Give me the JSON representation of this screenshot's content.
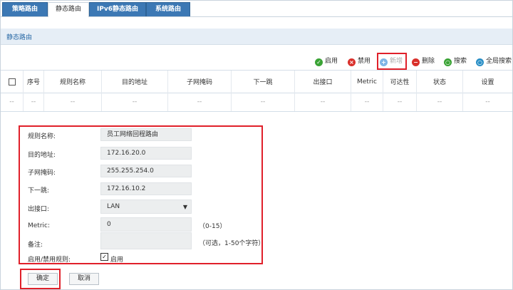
{
  "tabs": [
    {
      "label": "策略路由",
      "active": false
    },
    {
      "label": "静态路由",
      "active": true
    },
    {
      "label": "IPv6静态路由",
      "active": false
    },
    {
      "label": "系统路由",
      "active": false
    }
  ],
  "panel": {
    "title": "静态路由"
  },
  "toolbar": {
    "enable": "启用",
    "disable": "禁用",
    "add": "新增",
    "delete": "删除",
    "search": "搜索",
    "global_search": "全局搜索"
  },
  "table": {
    "headers": [
      "序号",
      "规则名称",
      "目的地址",
      "子网掩码",
      "下一跳",
      "出接口",
      "Metric",
      "可达性",
      "状态",
      "设置"
    ],
    "empty_row": [
      "--",
      "--",
      "--",
      "--",
      "--",
      "--",
      "--",
      "--",
      "--",
      "--",
      "--"
    ]
  },
  "form": {
    "rule_name_label": "规则名称:",
    "rule_name_value": "员工网络回程路由",
    "dest_label": "目的地址:",
    "dest_value": "172.16.20.0",
    "mask_label": "子网掩码:",
    "mask_value": "255.255.254.0",
    "nexthop_label": "下一跳:",
    "nexthop_value": "172.16.10.2",
    "iface_label": "出接口:",
    "iface_value": "LAN",
    "metric_label": "Metric:",
    "metric_value": "0",
    "metric_hint": "（0-15）",
    "note_label": "备注:",
    "note_value": "",
    "note_hint": "（可选，1-50个字符）",
    "enable_label": "启用/禁用规则:",
    "enable_checkbox_label": "启用",
    "enable_checked": true
  },
  "buttons": {
    "ok": "确定",
    "cancel": "取消"
  },
  "colors": {
    "tab_blue": "#3c78b4",
    "panel_bg": "#e6eef6",
    "highlight_red": "#e0202a",
    "enable_green": "#3aa335",
    "disable_red": "#d9302b",
    "add_blue": "#7fb6e6"
  }
}
